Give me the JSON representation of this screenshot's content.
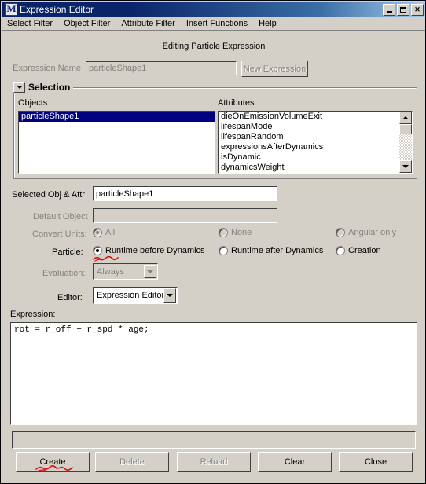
{
  "window": {
    "title": "Expression Editor",
    "icon": "maya-logo-icon",
    "minimize_label": "Minimize",
    "maximize_label": "Maximize",
    "close_label": "Close"
  },
  "menubar": {
    "items": [
      {
        "label": "Select Filter"
      },
      {
        "label": "Object Filter"
      },
      {
        "label": "Attribute Filter"
      },
      {
        "label": "Insert Functions"
      },
      {
        "label": "Help"
      }
    ]
  },
  "header": {
    "editing_title": "Editing Particle Expression"
  },
  "expression_name": {
    "label": "Expression Name",
    "value": "particleShape1",
    "placeholder": "",
    "new_expression_button": "New Expression"
  },
  "selection": {
    "group_title": "Selection",
    "objects_label": "Objects",
    "attributes_label": "Attributes",
    "objects": [
      {
        "label": "particleShape1",
        "selected": true
      }
    ],
    "attributes": [
      {
        "label": "dieOnEmissionVolumeExit",
        "selected": false
      },
      {
        "label": "lifespanMode",
        "selected": false
      },
      {
        "label": "lifespanRandom",
        "selected": false
      },
      {
        "label": "expressionsAfterDynamics",
        "selected": false
      },
      {
        "label": "isDynamic",
        "selected": false
      },
      {
        "label": "dynamicsWeight",
        "selected": false
      }
    ]
  },
  "fields": {
    "selected_obj_attr_label": "Selected Obj & Attr",
    "selected_obj_attr_value": "particleShape1",
    "default_object_label": "Default Object",
    "default_object_value": ""
  },
  "convert_units": {
    "label": "Convert Units:",
    "options": [
      {
        "label": "All",
        "checked": true
      },
      {
        "label": "None",
        "checked": false
      },
      {
        "label": "Angular only",
        "checked": false
      }
    ]
  },
  "particle": {
    "label": "Particle:",
    "options": [
      {
        "label": "Runtime before Dynamics",
        "checked": true
      },
      {
        "label": "Runtime after Dynamics",
        "checked": false
      },
      {
        "label": "Creation",
        "checked": false
      }
    ]
  },
  "evaluation": {
    "label": "Evaluation:",
    "value": "Always"
  },
  "editor": {
    "label": "Editor:",
    "value": "Expression Editor"
  },
  "expression": {
    "label": "Expression:",
    "text": "rot = r_off + r_spd * age;"
  },
  "status_bar": {
    "value": ""
  },
  "buttons": [
    {
      "label": "Create",
      "enabled": true
    },
    {
      "label": "Delete",
      "enabled": false
    },
    {
      "label": "Reload",
      "enabled": false
    },
    {
      "label": "Clear",
      "enabled": true
    },
    {
      "label": "Close",
      "enabled": true
    }
  ],
  "annotations": {
    "color": "#d81313",
    "marks": [
      {
        "name": "create-button-underline"
      },
      {
        "name": "runtime-before-dynamics-underline"
      }
    ]
  }
}
